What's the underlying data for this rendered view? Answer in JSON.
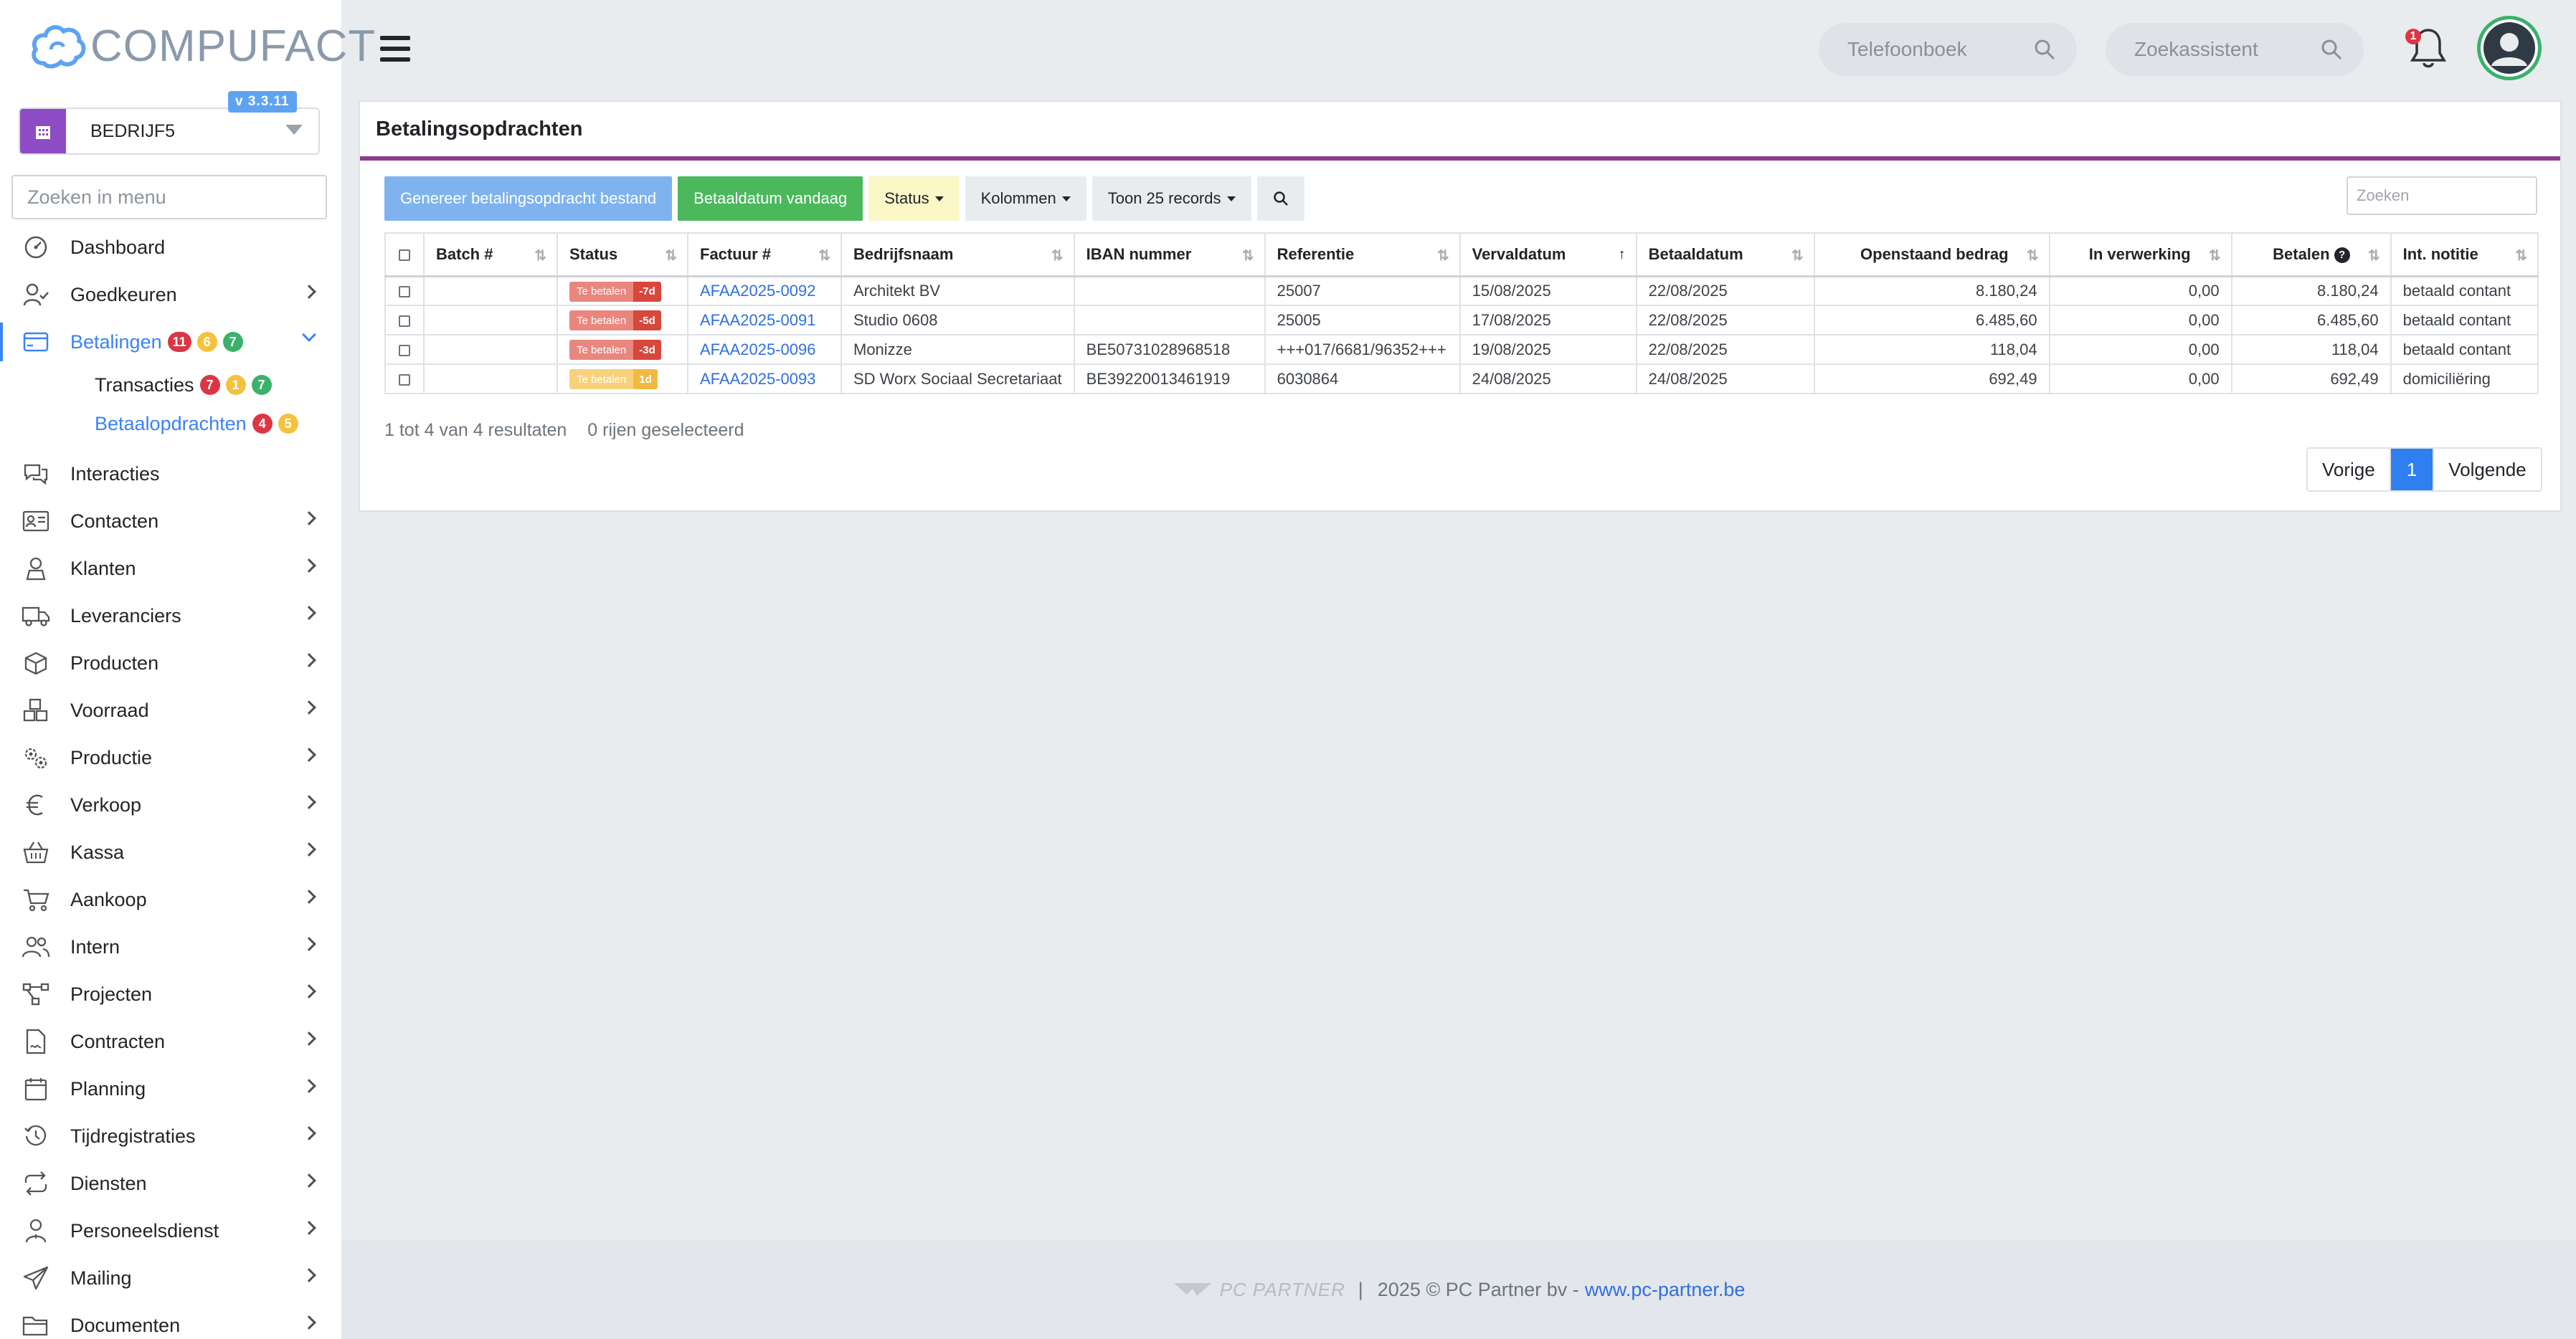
{
  "app": {
    "logo_text": "COMPUFACT",
    "version": "v 3.3.11",
    "company": "BEDRIJF5",
    "menu_search_placeholder": "Zoeken in menu"
  },
  "sidebar": {
    "items": [
      {
        "label": "Dashboard",
        "icon": "gauge-icon",
        "chevron": false
      },
      {
        "label": "Goedkeuren",
        "icon": "user-check-icon",
        "chevron": true
      },
      {
        "label": "Betalingen",
        "icon": "credit-card-icon",
        "chevron": true,
        "active": true,
        "badges": [
          "11",
          "6",
          "7"
        ]
      },
      {
        "label": "Interacties",
        "icon": "chat-icon",
        "chevron": false
      },
      {
        "label": "Contacten",
        "icon": "contact-card-icon",
        "chevron": true
      },
      {
        "label": "Klanten",
        "icon": "customer-icon",
        "chevron": true
      },
      {
        "label": "Leveranciers",
        "icon": "truck-icon",
        "chevron": true
      },
      {
        "label": "Producten",
        "icon": "box-icon",
        "chevron": true
      },
      {
        "label": "Voorraad",
        "icon": "boxes-icon",
        "chevron": true
      },
      {
        "label": "Productie",
        "icon": "gears-icon",
        "chevron": true
      },
      {
        "label": "Verkoop",
        "icon": "euro-icon",
        "chevron": true
      },
      {
        "label": "Kassa",
        "icon": "basket-icon",
        "chevron": true
      },
      {
        "label": "Aankoop",
        "icon": "cart-icon",
        "chevron": true
      },
      {
        "label": "Intern",
        "icon": "users-icon",
        "chevron": true
      },
      {
        "label": "Projecten",
        "icon": "project-diagram-icon",
        "chevron": true
      },
      {
        "label": "Contracten",
        "icon": "contract-icon",
        "chevron": true
      },
      {
        "label": "Planning",
        "icon": "calendar-icon",
        "chevron": true
      },
      {
        "label": "Tijdregistraties",
        "icon": "clock-history-icon",
        "chevron": true
      },
      {
        "label": "Diensten",
        "icon": "repeat-icon",
        "chevron": true
      },
      {
        "label": "Personeelsdienst",
        "icon": "person-icon",
        "chevron": true
      },
      {
        "label": "Mailing",
        "icon": "paper-plane-icon",
        "chevron": true
      },
      {
        "label": "Documenten",
        "icon": "folder-icon",
        "chevron": true
      }
    ],
    "subitems": [
      {
        "label": "Transacties",
        "badges": [
          "7",
          "1",
          "7"
        ]
      },
      {
        "label": "Betaalopdrachten",
        "badges": [
          "4",
          "5"
        ],
        "active": true
      }
    ]
  },
  "topbar": {
    "phonebook_placeholder": "Telefoonboek",
    "assistant_placeholder": "Zoekassistent",
    "notification_count": "1"
  },
  "page": {
    "title": "Betalingsopdrachten",
    "buttons": {
      "generate": "Genereer betalingsopdracht bestand",
      "today": "Betaaldatum vandaag",
      "status": "Status",
      "columns": "Kolommen",
      "show": "Toon 25 records"
    },
    "search_placeholder": "Zoeken",
    "columns": [
      "Batch #",
      "Status",
      "Factuur #",
      "Bedrijfsnaam",
      "IBAN nummer",
      "Referentie",
      "Vervaldatum",
      "Betaaldatum",
      "Openstaand bedrag",
      "In verwerking",
      "Betalen",
      "Int. notitie"
    ],
    "rows": [
      {
        "batch": "",
        "status": "Te betalen",
        "days": "-7d",
        "invoice": "AFAA2025-0092",
        "company": "Architekt BV",
        "iban": "",
        "ref": "25007",
        "due": "15/08/2025",
        "paydate": "22/08/2025",
        "open": "8.180,24",
        "processing": "0,00",
        "pay": "8.180,24",
        "note": "betaald contant"
      },
      {
        "batch": "",
        "status": "Te betalen",
        "days": "-5d",
        "invoice": "AFAA2025-0091",
        "company": "Studio 0608",
        "iban": "",
        "ref": "25005",
        "due": "17/08/2025",
        "paydate": "22/08/2025",
        "open": "6.485,60",
        "processing": "0,00",
        "pay": "6.485,60",
        "note": "betaald contant"
      },
      {
        "batch": "",
        "status": "Te betalen",
        "days": "-3d",
        "invoice": "AFAA2025-0096",
        "company": "Monizze",
        "iban": "BE50731028968518",
        "ref": "+++017/6681/96352+++",
        "due": "19/08/2025",
        "paydate": "22/08/2025",
        "open": "118,04",
        "processing": "0,00",
        "pay": "118,04",
        "note": "betaald contant"
      },
      {
        "batch": "",
        "status": "Te betalen",
        "days": "1d",
        "invoice": "AFAA2025-0093",
        "company": "SD Worx Sociaal Secretariaat",
        "iban": "BE39220013461919",
        "ref": "6030864",
        "due": "24/08/2025",
        "paydate": "24/08/2025",
        "open": "692,49",
        "processing": "0,00",
        "pay": "692,49",
        "note": "domiciliëring"
      }
    ],
    "result_info": "1 tot 4 van 4 resultaten",
    "selected_info": "0 rijen geselecteerd",
    "pager": {
      "prev": "Vorige",
      "current": "1",
      "next": "Volgende"
    }
  },
  "footer": {
    "brand": "PC PARTNER",
    "separator": "|",
    "copyright": "2025 © PC Partner bv - ",
    "link": "www.pc-partner.be"
  },
  "colors": {
    "accent_purple": "#8e3c8f",
    "primary_blue": "#3b82f6",
    "badge_red": "#dc3545",
    "badge_yellow": "#f5c23d",
    "badge_green": "#3bb16a"
  }
}
